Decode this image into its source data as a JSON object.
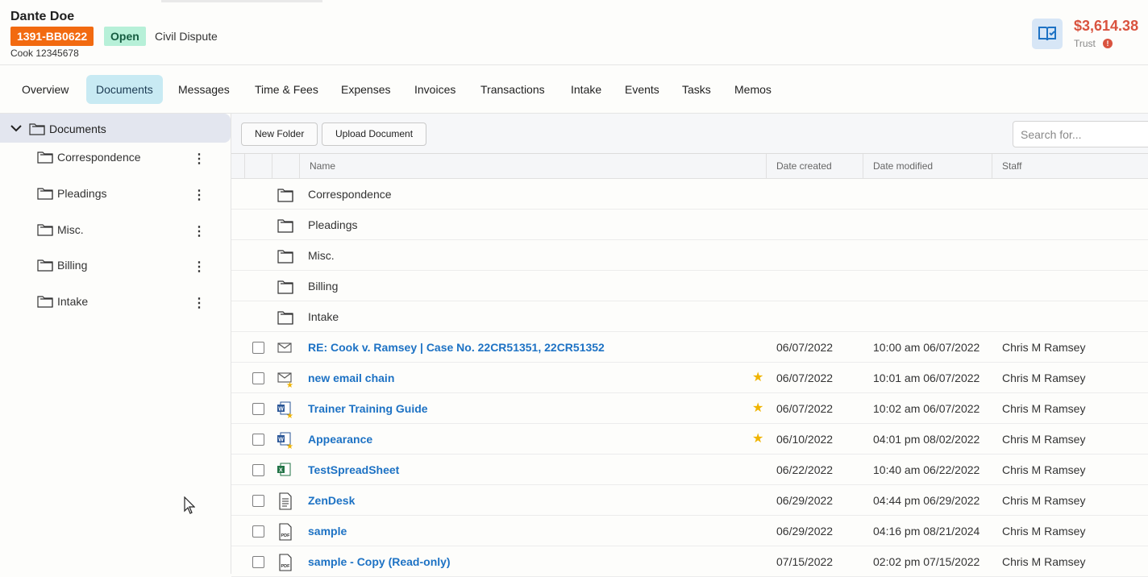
{
  "header": {
    "client_name": "Dante Doe",
    "case_number": "1391-BB0622",
    "status": "Open",
    "case_type": "Civil Dispute",
    "case_sub": "Cook 12345678",
    "trust_amount": "$3,614.38",
    "trust_label": "Trust",
    "alert_glyph": "!"
  },
  "tabs": [
    "Overview",
    "Documents",
    "Messages",
    "Time & Fees",
    "Expenses",
    "Invoices",
    "Transactions",
    "Intake",
    "Events",
    "Tasks",
    "Memos"
  ],
  "active_tab": "Documents",
  "sidebar": {
    "root": "Documents",
    "folders": [
      "Correspondence",
      "Pleadings",
      "Misc.",
      "Billing",
      "Intake"
    ]
  },
  "toolbar": {
    "new_folder": "New Folder",
    "upload_document": "Upload Document",
    "search_placeholder": "Search for..."
  },
  "table": {
    "columns": {
      "name": "Name",
      "date_created": "Date created",
      "date_modified": "Date modified",
      "staff": "Staff"
    },
    "folders": [
      "Correspondence",
      "Pleadings",
      "Misc.",
      "Billing",
      "Intake"
    ],
    "documents": [
      {
        "name": "RE: Cook v. Ramsey | Case No. 22CR51351, 22CR51352",
        "icon": "email-icon",
        "starred": false,
        "created": "06/07/2022",
        "modified": "10:00 am 06/07/2022",
        "staff": "Chris M Ramsey"
      },
      {
        "name": "new email chain",
        "icon": "email-starred-icon",
        "starred": true,
        "created": "06/07/2022",
        "modified": "10:01 am 06/07/2022",
        "staff": "Chris M Ramsey"
      },
      {
        "name": "Trainer Training Guide",
        "icon": "word-starred-icon",
        "starred": true,
        "created": "06/07/2022",
        "modified": "10:02 am 06/07/2022",
        "staff": "Chris M Ramsey"
      },
      {
        "name": "Appearance",
        "icon": "word-starred-icon",
        "starred": true,
        "created": "06/10/2022",
        "modified": "04:01 pm 08/02/2022",
        "staff": "Chris M Ramsey"
      },
      {
        "name": "TestSpreadSheet",
        "icon": "excel-icon",
        "starred": false,
        "created": "06/22/2022",
        "modified": "10:40 am 06/22/2022",
        "staff": "Chris M Ramsey"
      },
      {
        "name": "ZenDesk",
        "icon": "text-document-icon",
        "starred": false,
        "created": "06/29/2022",
        "modified": "04:44 pm 06/29/2022",
        "staff": "Chris M Ramsey"
      },
      {
        "name": "sample",
        "icon": "pdf-icon",
        "starred": false,
        "created": "06/29/2022",
        "modified": "04:16 pm 08/21/2024",
        "staff": "Chris M Ramsey"
      },
      {
        "name": "sample - Copy (Read-only)",
        "icon": "pdf-icon",
        "starred": false,
        "created": "07/15/2022",
        "modified": "02:02 pm 07/15/2022",
        "staff": "Chris M Ramsey"
      }
    ]
  },
  "colors": {
    "case_number_bg": "#f26a10",
    "status_bg": "#b7f0d8",
    "trust_amount": "#d9533f",
    "link": "#1d72c4",
    "active_tab_bg": "#c8eaf3",
    "star": "#f0b400"
  }
}
